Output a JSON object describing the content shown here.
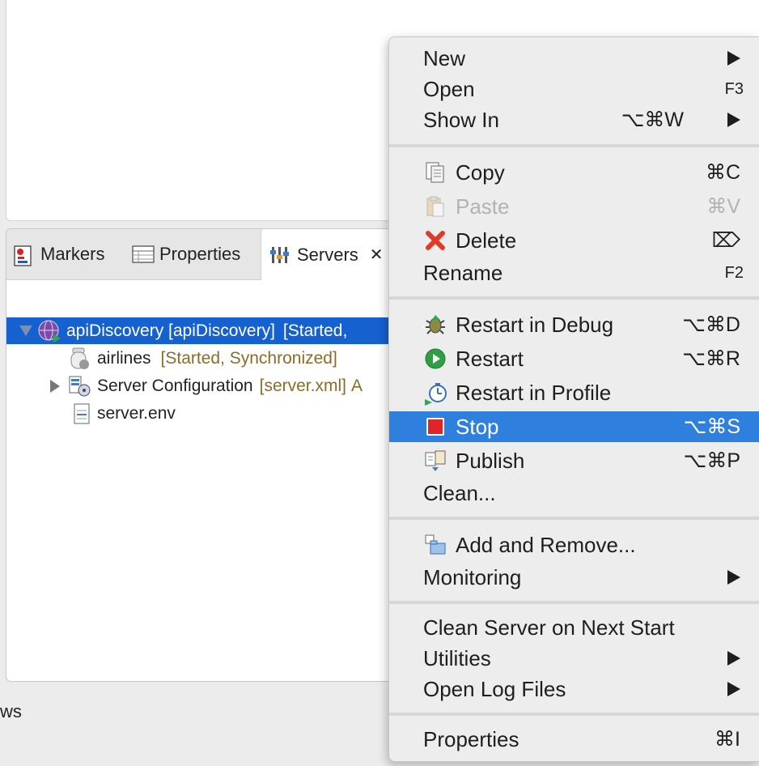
{
  "tabs": [
    {
      "label": "Markers",
      "icon": "markers-icon"
    },
    {
      "label": "Properties",
      "icon": "properties-icon"
    },
    {
      "label": "Servers",
      "icon": "servers-icon",
      "close": "✕"
    }
  ],
  "tree": {
    "server": {
      "label": "apiDiscovery [apiDiscovery]",
      "status": "[Started,"
    },
    "children": [
      {
        "label": "airlines",
        "decoration": "[Started, Synchronized]"
      },
      {
        "label": "Server Configuration",
        "decoration": "[server.xml]",
        "trail": "A"
      },
      {
        "label": "server.env"
      }
    ]
  },
  "status_text": "ws",
  "menu": {
    "group1": [
      {
        "label": "New",
        "submenu": true
      },
      {
        "label": "Open",
        "shortcut": "F3"
      },
      {
        "label": "Show In",
        "shortcut": "⌥⌘W",
        "submenu": true
      }
    ],
    "group2": [
      {
        "label": "Copy",
        "shortcut": "⌘C",
        "icon": "copy-icon"
      },
      {
        "label": "Paste",
        "shortcut": "⌘V",
        "icon": "paste-icon",
        "disabled": true
      },
      {
        "label": "Delete",
        "shortcut": "⌦",
        "icon": "delete-icon"
      },
      {
        "label": "Rename",
        "shortcut": "F2"
      }
    ],
    "group3": [
      {
        "label": "Restart in Debug",
        "shortcut": "⌥⌘D",
        "icon": "debug-icon"
      },
      {
        "label": "Restart",
        "shortcut": "⌥⌘R",
        "icon": "restart-icon"
      },
      {
        "label": "Restart in Profile",
        "icon": "profile-icon"
      },
      {
        "label": "Stop",
        "shortcut": "⌥⌘S",
        "icon": "stop-icon",
        "highlighted": true
      },
      {
        "label": "Publish",
        "shortcut": "⌥⌘P",
        "icon": "publish-icon"
      },
      {
        "label": "Clean..."
      }
    ],
    "group4": [
      {
        "label": "Add and Remove...",
        "icon": "add-remove-icon"
      },
      {
        "label": "Monitoring",
        "submenu": true
      }
    ],
    "group5": [
      {
        "label": "Clean Server on Next Start"
      },
      {
        "label": "Utilities",
        "submenu": true
      },
      {
        "label": "Open Log Files",
        "submenu": true
      }
    ],
    "group6": [
      {
        "label": "Properties",
        "shortcut": "⌘I"
      }
    ]
  },
  "colors": {
    "selection": "#1661d0",
    "menu_highlight": "#2f7fde",
    "decoration": "#8b6b2a"
  }
}
